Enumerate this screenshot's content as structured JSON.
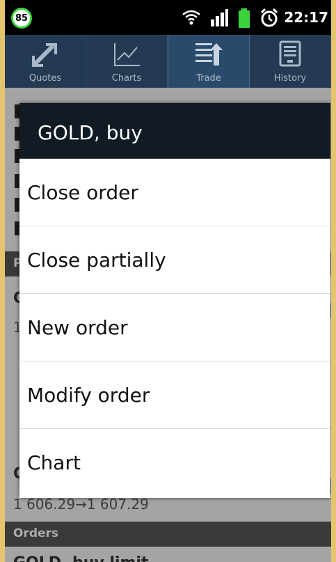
{
  "status_bar": {
    "battery_level": "85",
    "time": "22:17",
    "icons": [
      "wifi-icon",
      "signal-icon",
      "battery-icon",
      "alarm-icon"
    ]
  },
  "tabs": [
    {
      "label": "Quotes",
      "icon": "quotes-icon",
      "active": false
    },
    {
      "label": "Charts",
      "icon": "charts-icon",
      "active": false
    },
    {
      "label": "Trade",
      "icon": "trade-icon",
      "active": true
    },
    {
      "label": "History",
      "icon": "history-icon",
      "active": false
    }
  ],
  "background": {
    "positions_header_partial": "P",
    "orders_header": "Orders",
    "price_line": "1 606.29→1 607.29",
    "order_partial": "GOLD, buy limit"
  },
  "dialog": {
    "title": "GOLD, buy",
    "items": [
      "Close order",
      "Close partially",
      "New order",
      "Modify order",
      "Chart"
    ]
  },
  "colors": {
    "tab_bar": "#233a52",
    "dialog_title_bg": "#121a24",
    "accent_blue": "#1b4fa0",
    "battery_green": "#3cd43c"
  }
}
